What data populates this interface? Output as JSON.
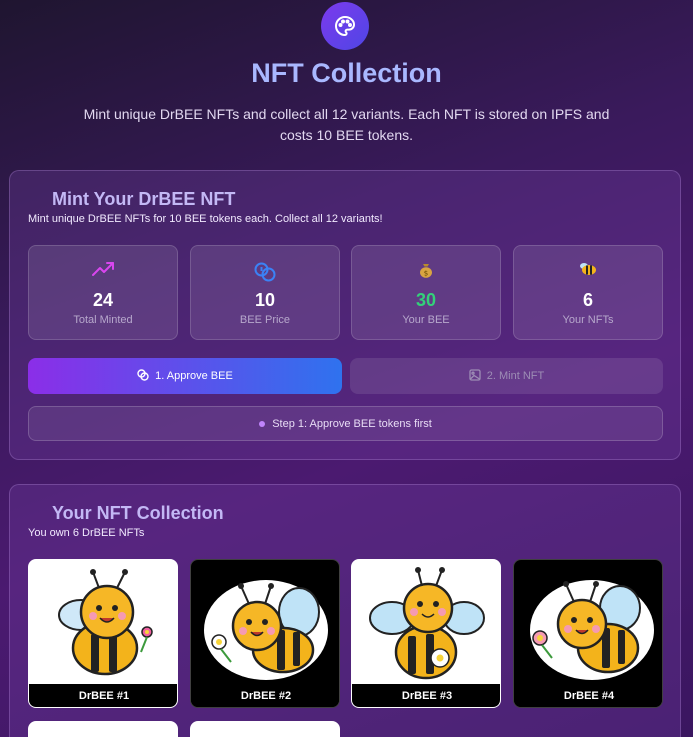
{
  "header": {
    "icon": "palette-icon",
    "title": "NFT Collection",
    "subtitle": "Mint unique DrBEE NFTs and collect all 12 variants. Each NFT is stored on IPFS and costs 10 BEE tokens."
  },
  "mint": {
    "title": "Mint Your DrBEE NFT",
    "subtitle": "Mint unique DrBEE NFTs for 10 BEE tokens each. Collect all 12 variants!",
    "stats": [
      {
        "icon": "trending-up-icon",
        "value": "24",
        "label": "Total Minted"
      },
      {
        "icon": "coins-icon",
        "value": "10",
        "label": "BEE Price"
      },
      {
        "icon": "money-bag-icon",
        "value": "30",
        "label": "Your BEE"
      },
      {
        "icon": "bee-icon",
        "value": "6",
        "label": "Your NFTs"
      }
    ],
    "approve_label": "1. Approve BEE",
    "mint_label": "2. Mint NFT",
    "status": "Step 1: Approve BEE tokens first"
  },
  "collection": {
    "title": "Your NFT Collection",
    "subtitle": "You own 6 DrBEE NFTs",
    "items": [
      {
        "name": "DrBEE #1",
        "bg": "#ffffff"
      },
      {
        "name": "DrBEE #2",
        "bg": "#000000"
      },
      {
        "name": "DrBEE #3",
        "bg": "#ffffff"
      },
      {
        "name": "DrBEE #4",
        "bg": "#000000"
      }
    ]
  },
  "colors": {
    "accent": "#8b2ee8",
    "accent2": "#2f72ee",
    "title": "#a9b8ff",
    "green": "#34d17a"
  }
}
